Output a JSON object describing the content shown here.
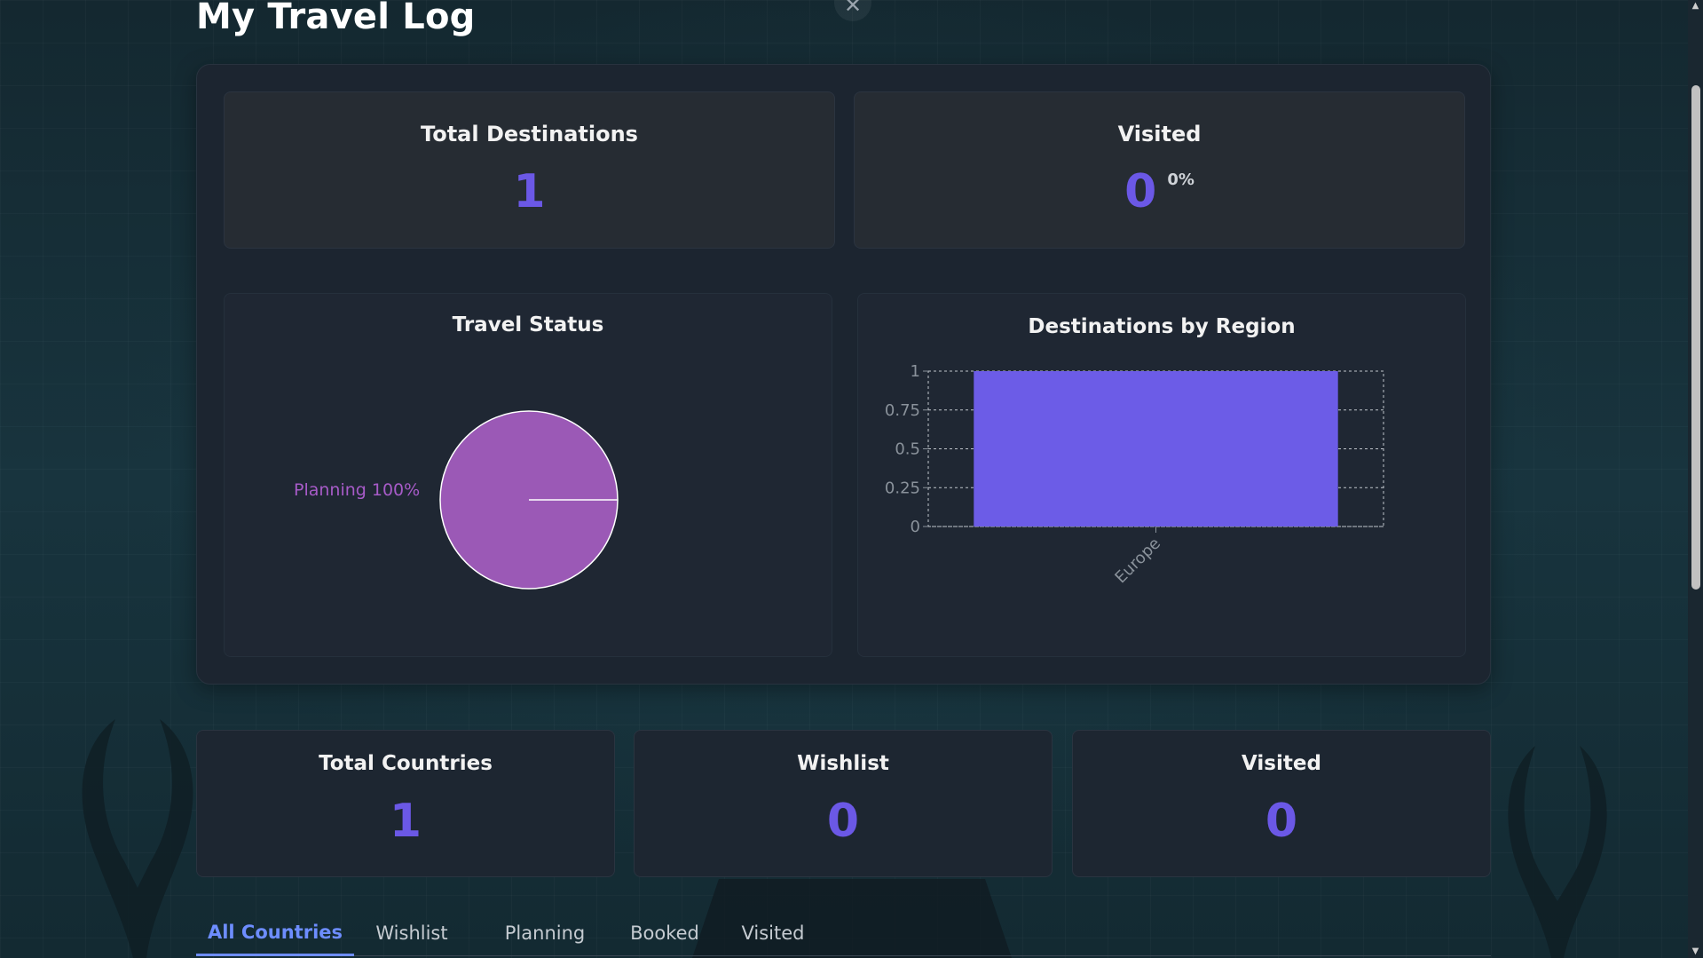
{
  "page": {
    "title": "My Travel Log",
    "close_icon": "close-icon"
  },
  "summary": {
    "total_destinations": {
      "label": "Total Destinations",
      "value": "1"
    },
    "visited": {
      "label": "Visited",
      "value": "0",
      "percent": "0%"
    }
  },
  "travel_status": {
    "title": "Travel Status",
    "slice_label": "Planning 100%"
  },
  "region_chart": {
    "title": "Destinations by Region"
  },
  "chart_data": [
    {
      "type": "pie",
      "title": "Travel Status",
      "categories": [
        "Planning"
      ],
      "values": [
        100
      ],
      "labels": [
        "Planning 100%"
      ],
      "colors": [
        "#9b59b6"
      ]
    },
    {
      "type": "bar",
      "title": "Destinations by Region",
      "categories": [
        "Europe"
      ],
      "values": [
        1
      ],
      "ylim": [
        0,
        1
      ],
      "yticks": [
        "0",
        "0.25",
        "0.5",
        "0.75",
        "1"
      ],
      "grid": true,
      "colors": [
        "#6c5ce7"
      ]
    }
  ],
  "countries": {
    "total": {
      "label": "Total Countries",
      "value": "1"
    },
    "wishlist": {
      "label": "Wishlist",
      "value": "0"
    },
    "visited": {
      "label": "Visited",
      "value": "0"
    }
  },
  "tabs": [
    {
      "label": "All Countries",
      "active": true
    },
    {
      "label": "Wishlist",
      "active": false
    },
    {
      "label": "Planning",
      "active": false
    },
    {
      "label": "Booked",
      "active": false
    },
    {
      "label": "Visited",
      "active": false
    }
  ],
  "colors": {
    "accent": "#6b58e6",
    "tab_active": "#6d8dff",
    "pie": "#9b59b6",
    "bar": "#6c5ce7"
  }
}
